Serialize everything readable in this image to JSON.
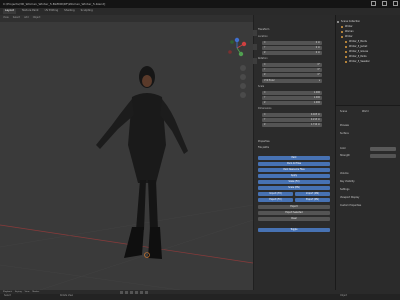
{
  "titlebar": {
    "title": "C:\\Projects\\3D_Woman_Winter_5.BLEND\\RF\\Woman_Winter_5.blend]"
  },
  "menubar": {
    "items": [
      "Layout",
      "Texture Paint",
      "UV Editing",
      "Shading",
      "Sculpting"
    ]
  },
  "viewport": {
    "header_items": [
      "View",
      "Select",
      "Add",
      "Object"
    ]
  },
  "npanel": {
    "transform": "Transform",
    "location": "Location",
    "rotation": "Rotation",
    "xyz_euler": "XYZ Euler",
    "scale": "Scale",
    "dimensions": "Dimensions",
    "properties": "Properties",
    "scale_values": [
      "1.000",
      "1.000",
      "1.000"
    ],
    "dim_values": [
      "0.405 m",
      "0.213 m",
      "1.710 m"
    ],
    "zero_values": [
      "0 m",
      "0 m",
      "0 m",
      "0°",
      "0°",
      "0°"
    ],
    "axes": [
      "X",
      "Y",
      "Z"
    ],
    "file_paths": "File paths",
    "buttons": [
      "Pack",
      "Pack All Files",
      "Pack Resource Files",
      "Apply",
      "Scale (FX)",
      "Scale (MS)",
      "Import (FX)",
      "Import (MS)",
      "Export (FX)",
      "Export (MS)",
      "Export",
      "Export Selected",
      "Clear",
      "Toggle"
    ]
  },
  "outliner": {
    "rows": [
      {
        "label": "Scene Collection",
        "color": "#aaaaaa"
      },
      {
        "label": "Winter",
        "color": "#e0a040"
      },
      {
        "label": "Woman",
        "color": "#e0a040"
      },
      {
        "label": "Winter",
        "color": "#e0a040"
      },
      {
        "label": "Winter_5_Boots",
        "color": "#e0a040"
      },
      {
        "label": "Winter_5_Jacket",
        "color": "#e0a040"
      },
      {
        "label": "Winter_5_Gloves",
        "color": "#e0a040"
      },
      {
        "label": "Winter_5_Pants",
        "color": "#e0a040"
      },
      {
        "label": "Winter_5_Sweater",
        "color": "#e0a040"
      }
    ]
  },
  "properties": {
    "header": [
      "Scene",
      "World"
    ],
    "items": [
      "Preview",
      "Surface",
      "Color",
      "Strength",
      "Volume",
      "Ray Visibility",
      "Settings",
      "Viewport Display",
      "Custom Properties"
    ]
  },
  "timeline": {
    "items": [
      "Playback",
      "Keying",
      "View",
      "Marker"
    ]
  },
  "status": {
    "left": "Select",
    "mid": "Rotate View",
    "right": "Object"
  }
}
